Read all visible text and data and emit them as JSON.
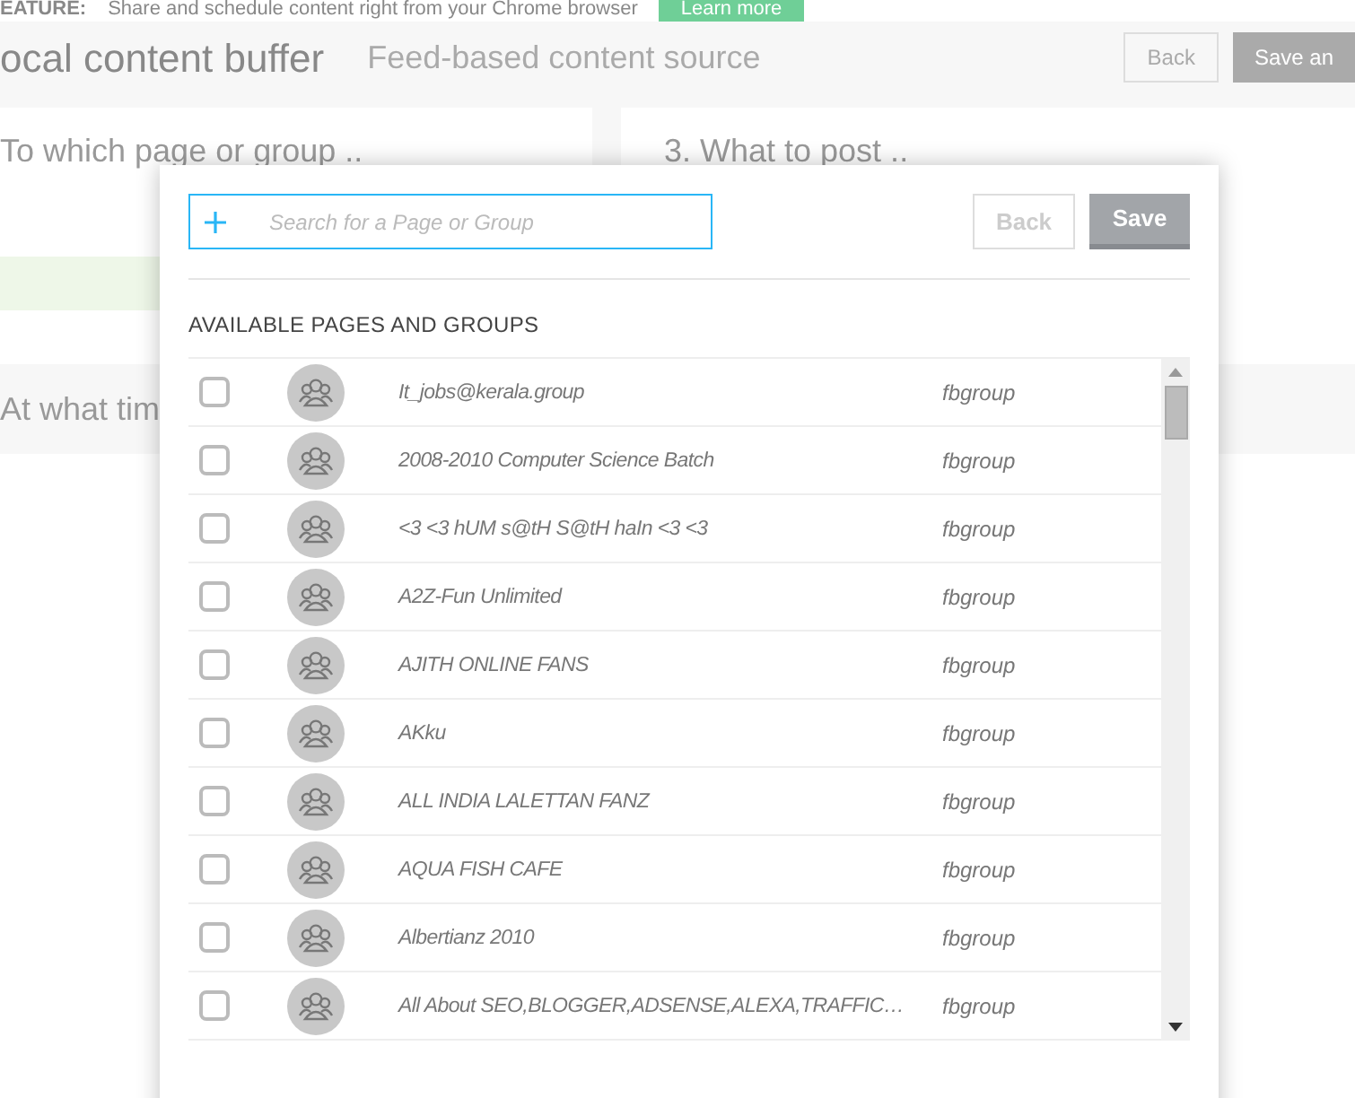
{
  "background": {
    "banner": {
      "label": "EATURE:",
      "text": "Share and schedule content right from your Chrome browser",
      "button": "Learn more"
    },
    "title": "ocal content buffer",
    "subtitle": "Feed-based content source",
    "buttons": [
      "Back",
      "Save an"
    ],
    "steps": [
      "To which page or group ..",
      "3.  What to post .."
    ],
    "step_partial": "At what tim"
  },
  "dialog": {
    "search": {
      "placeholder": "Search for a Page or Group"
    },
    "back": "Back",
    "save": "Save",
    "heading": "AVAILABLE PAGES AND GROUPS",
    "rows": [
      {
        "name": "It_jobs@kerala.group",
        "type": "fbgroup",
        "checked": false
      },
      {
        "name": "2008-2010 Computer Science Batch",
        "type": "fbgroup",
        "checked": false
      },
      {
        "name": "<3 <3 hUM s@tH S@tH haIn <3 <3",
        "type": "fbgroup",
        "checked": false
      },
      {
        "name": "A2Z-Fun Unlimited",
        "type": "fbgroup",
        "checked": false
      },
      {
        "name": "AJITH ONLINE FANS",
        "type": "fbgroup",
        "checked": false
      },
      {
        "name": "AKku",
        "type": "fbgroup",
        "checked": false
      },
      {
        "name": "ALL INDIA LALETTAN FANZ",
        "type": "fbgroup",
        "checked": false
      },
      {
        "name": "AQUA FISH CAFE",
        "type": "fbgroup",
        "checked": false
      },
      {
        "name": "Albertianz 2010",
        "type": "fbgroup",
        "checked": false
      },
      {
        "name": "All About SEO,BLOGGER,ADSENSE,ALEXA,TRAFFIC…",
        "type": "fbgroup",
        "checked": false
      }
    ]
  }
}
